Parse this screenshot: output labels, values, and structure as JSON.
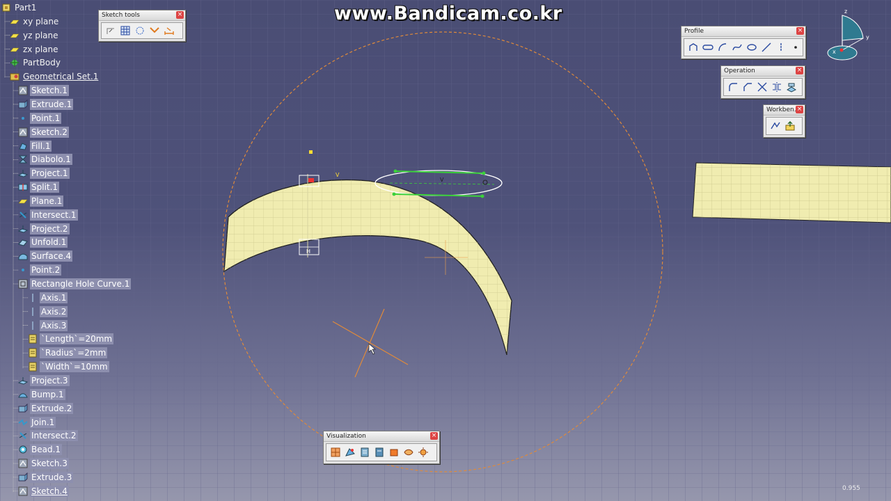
{
  "watermark": "www.Bandicam.co.kr",
  "tree": [
    {
      "label": "Part1",
      "icon": "part-icon",
      "level": 0
    },
    {
      "label": "xy plane",
      "icon": "plane-icon",
      "level": 1
    },
    {
      "label": "yz plane",
      "icon": "plane-icon",
      "level": 1
    },
    {
      "label": "zx plane",
      "icon": "plane-icon",
      "level": 1
    },
    {
      "label": "PartBody",
      "icon": "partbody-icon",
      "level": 1
    },
    {
      "label": "Geometrical Set.1",
      "icon": "geometrical-set-icon",
      "level": 1,
      "underline": true
    },
    {
      "label": "Sketch.1",
      "icon": "sketch-icon",
      "level": 2,
      "highlight": true
    },
    {
      "label": "Extrude.1",
      "icon": "extrude-icon",
      "level": 2,
      "highlight": true
    },
    {
      "label": "Point.1",
      "icon": "point-icon",
      "level": 2,
      "highlight": true
    },
    {
      "label": "Sketch.2",
      "icon": "sketch-icon",
      "level": 2,
      "highlight": true
    },
    {
      "label": "Fill.1",
      "icon": "fill-icon",
      "level": 2,
      "highlight": true
    },
    {
      "label": "Diabolo.1",
      "icon": "diabolo-icon",
      "level": 2,
      "highlight": true
    },
    {
      "label": "Project.1",
      "icon": "project-icon",
      "level": 2,
      "highlight": true
    },
    {
      "label": "Split.1",
      "icon": "split-icon",
      "level": 2,
      "highlight": true
    },
    {
      "label": "Plane.1",
      "icon": "plane-icon",
      "level": 2,
      "highlight": true
    },
    {
      "label": "Intersect.1",
      "icon": "intersect-icon",
      "level": 2,
      "highlight": true
    },
    {
      "label": "Project.2",
      "icon": "project-icon",
      "level": 2,
      "highlight": true
    },
    {
      "label": "Unfold.1",
      "icon": "unfold-icon",
      "level": 2,
      "highlight": true
    },
    {
      "label": "Surface.4",
      "icon": "surface-icon",
      "level": 2,
      "highlight": true
    },
    {
      "label": "Point.2",
      "icon": "point-icon",
      "level": 2,
      "highlight": true
    },
    {
      "label": "Rectangle Hole Curve.1",
      "icon": "udf-icon",
      "level": 2,
      "highlight": true
    },
    {
      "label": "Axis.1",
      "icon": "axis-icon",
      "level": 3,
      "highlight": true
    },
    {
      "label": "Axis.2",
      "icon": "axis-icon",
      "level": 3,
      "highlight": true
    },
    {
      "label": "Axis.3",
      "icon": "axis-icon",
      "level": 3,
      "highlight": true
    },
    {
      "label": "`Length`=20mm",
      "icon": "parameter-icon",
      "level": 3,
      "highlight": true
    },
    {
      "label": "`Radius`=2mm",
      "icon": "parameter-icon",
      "level": 3,
      "highlight": true
    },
    {
      "label": "`Width`=10mm",
      "icon": "parameter-icon",
      "level": 3,
      "highlight": true
    },
    {
      "label": "Project.3",
      "icon": "project-icon",
      "level": 2,
      "highlight": true
    },
    {
      "label": "Bump.1",
      "icon": "bump-icon",
      "level": 2,
      "highlight": true
    },
    {
      "label": "Extrude.2",
      "icon": "extrude-icon",
      "level": 2,
      "highlight": true
    },
    {
      "label": "Join.1",
      "icon": "join-icon",
      "level": 2,
      "highlight": true
    },
    {
      "label": "Intersect.2",
      "icon": "intersect-icon",
      "level": 2,
      "highlight": true
    },
    {
      "label": "Bead.1",
      "icon": "bead-icon",
      "level": 2,
      "highlight": true
    },
    {
      "label": "Sketch.3",
      "icon": "sketch-icon",
      "level": 2,
      "highlight": true
    },
    {
      "label": "Extrude.3",
      "icon": "extrude-icon",
      "level": 2,
      "highlight": true
    },
    {
      "label": "Sketch.4",
      "icon": "sketch-icon",
      "level": 2,
      "highlight": true,
      "underline": true
    }
  ],
  "toolbars": {
    "sketch_tools": {
      "title": "Sketch tools",
      "buttons": [
        "snap-to-point-icon",
        "grid-icon",
        "construction-element-icon",
        "geometric-constraint-icon",
        "dimensional-constraint-icon"
      ]
    },
    "profile": {
      "title": "Profile",
      "buttons": [
        "profile-icon",
        "oblong-icon",
        "arc-icon",
        "spline-icon",
        "circle-icon",
        "line-icon",
        "axis-line-icon",
        "point-icon"
      ]
    },
    "operation": {
      "title": "Operation",
      "buttons": [
        "corner-icon",
        "chamfer-icon",
        "trim-icon",
        "mirror-icon",
        "project-3d-icon"
      ]
    },
    "workbench": {
      "title": "Workben...",
      "buttons": [
        "exit-workbench-icon",
        "update-icon"
      ]
    },
    "visualization": {
      "title": "Visualization",
      "buttons": [
        "cut-part-icon",
        "sketch-only-icon",
        "diagnosis-icon",
        "dimensional-constraints-icon",
        "render-style-icon",
        "hide-show-icon",
        "lighting-icon"
      ]
    }
  },
  "compass": {
    "x_label": "x",
    "y_label": "y",
    "z_label": "z"
  },
  "sketch": {
    "v_label": "V",
    "h_label": "H"
  },
  "status": {
    "zoom": "0.955"
  },
  "colors": {
    "surface_fill": "#f0ecb0",
    "grid_line": "#6a6c92",
    "construction": "#e08a3a",
    "selected": "#3bd13b",
    "background_top": "#4a4d74",
    "background_bottom": "#9697ad"
  }
}
